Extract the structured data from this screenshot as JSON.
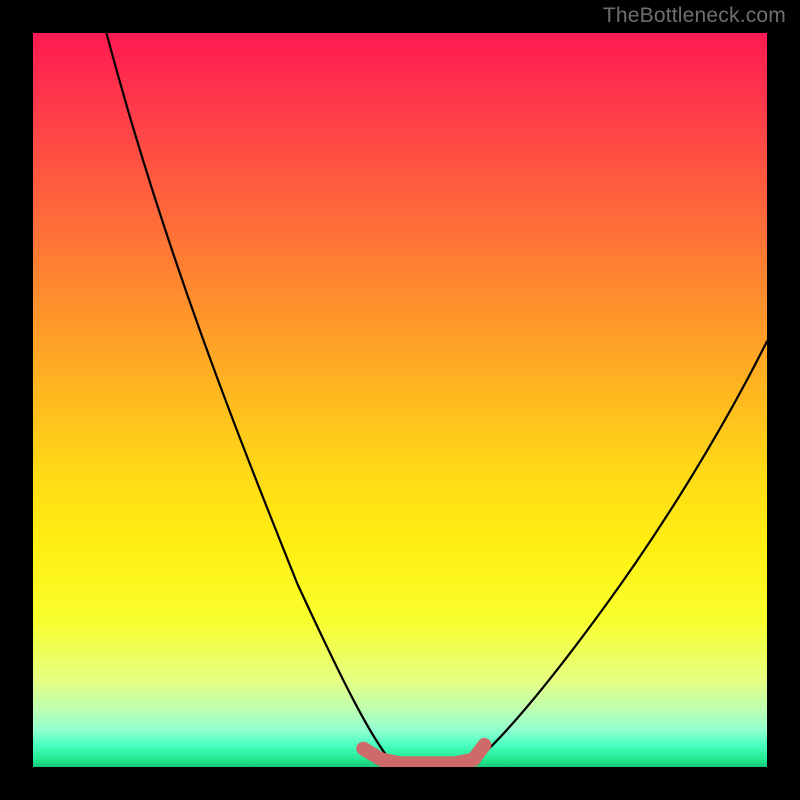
{
  "watermark": "TheBottleneck.com",
  "colors": {
    "curve": "#000000",
    "marker": "#cf6a6a",
    "frame": "#000000"
  },
  "chart_data": {
    "type": "line",
    "title": "",
    "xlabel": "",
    "ylabel": "",
    "xlim": [
      0,
      100
    ],
    "ylim": [
      0,
      100
    ],
    "grid": false,
    "legend": false,
    "series": [
      {
        "name": "left-branch",
        "x": [
          10,
          15,
          20,
          25,
          30,
          35,
          40,
          44,
          47,
          49
        ],
        "y": [
          100,
          82,
          66,
          51,
          38,
          26,
          15,
          6,
          2,
          0.5
        ]
      },
      {
        "name": "right-branch",
        "x": [
          60,
          62,
          65,
          70,
          75,
          80,
          85,
          90,
          95,
          100
        ],
        "y": [
          0.5,
          2,
          5,
          11,
          18,
          26,
          34,
          42,
          50,
          58
        ]
      },
      {
        "name": "bottom-marker",
        "x": [
          45,
          47.5,
          50,
          52.5,
          55,
          57.5,
          60,
          61.5
        ],
        "y": [
          2.5,
          1,
          0.5,
          0.5,
          0.5,
          0.5,
          1,
          3
        ]
      }
    ],
    "annotations": []
  }
}
